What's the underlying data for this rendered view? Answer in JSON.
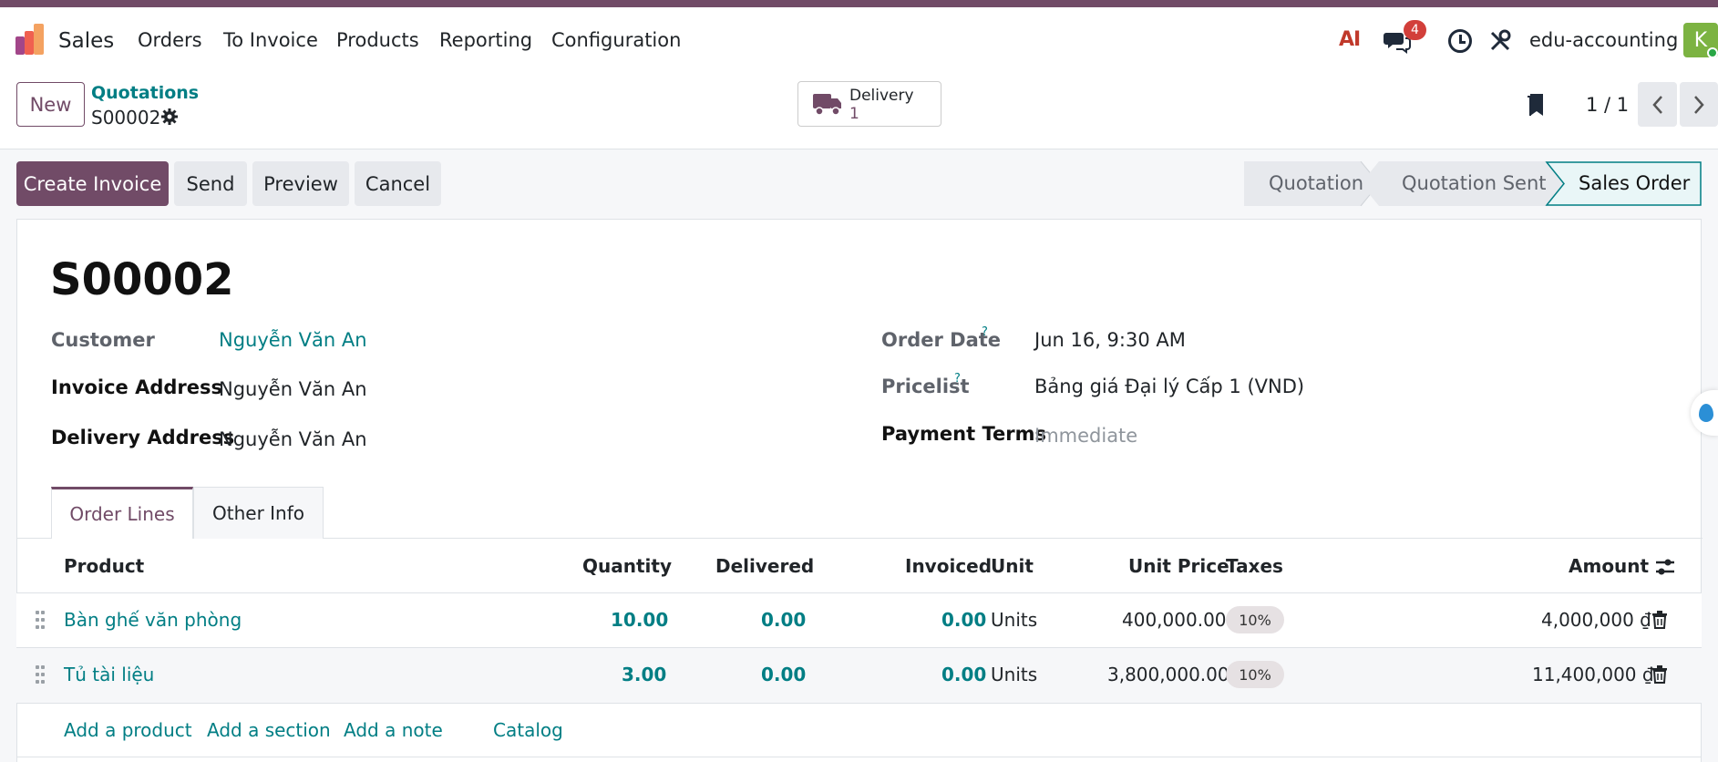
{
  "nav": {
    "app_name": "Sales",
    "menu": [
      "Orders",
      "To Invoice",
      "Products",
      "Reporting",
      "Configuration"
    ],
    "ai_label": "AI",
    "messages_badge": "4",
    "company": "edu-accounting",
    "avatar_letter": "K"
  },
  "control": {
    "new_label": "New",
    "breadcrumb_parent": "Quotations",
    "record_name": "S00002",
    "delivery_label": "Delivery",
    "delivery_count": "1",
    "pager": "1 / 1"
  },
  "actions": {
    "create_invoice": "Create Invoice",
    "send": "Send",
    "preview": "Preview",
    "cancel": "Cancel"
  },
  "status": {
    "steps": [
      "Quotation",
      "Quotation Sent",
      "Sales Order"
    ],
    "active": "Sales Order"
  },
  "form": {
    "title": "S00002",
    "customer_label": "Customer",
    "customer_value": "Nguyễn Văn An",
    "invoice_address_label": "Invoice Address",
    "invoice_address_value": "Nguyễn Văn An",
    "delivery_address_label": "Delivery Address",
    "delivery_address_value": "Nguyễn Văn An",
    "order_date_label": "Order Date",
    "order_date_value": "Jun 16, 9:30 AM",
    "pricelist_label": "Pricelist",
    "pricelist_value": "Bảng giá Đại lý Cấp 1 (VND)",
    "payment_terms_label": "Payment Terms",
    "payment_terms_placeholder": "Immediate",
    "help_mark": "?"
  },
  "tabs": [
    "Order Lines",
    "Other Info"
  ],
  "table": {
    "headers": [
      "Product",
      "Quantity",
      "Delivered",
      "Invoiced",
      "Unit",
      "Unit Price",
      "Taxes",
      "Amount"
    ],
    "rows": [
      {
        "product": "Bàn ghế văn phòng",
        "quantity": "10.00",
        "delivered": "0.00",
        "invoiced": "0.00",
        "unit": "Units",
        "unit_price": "400,000.00",
        "tax": "10%",
        "amount": "4,000,000 ₫"
      },
      {
        "product": "Tủ tài liệu",
        "quantity": "3.00",
        "delivered": "0.00",
        "invoiced": "0.00",
        "unit": "Units",
        "unit_price": "3,800,000.00",
        "tax": "10%",
        "amount": "11,400,000 ₫"
      }
    ],
    "add_links": [
      "Add a product",
      "Add a section",
      "Add a note",
      "Catalog"
    ]
  },
  "colors": {
    "brand": "#714b67",
    "link": "#017e84",
    "danger": "#d23f3a"
  }
}
